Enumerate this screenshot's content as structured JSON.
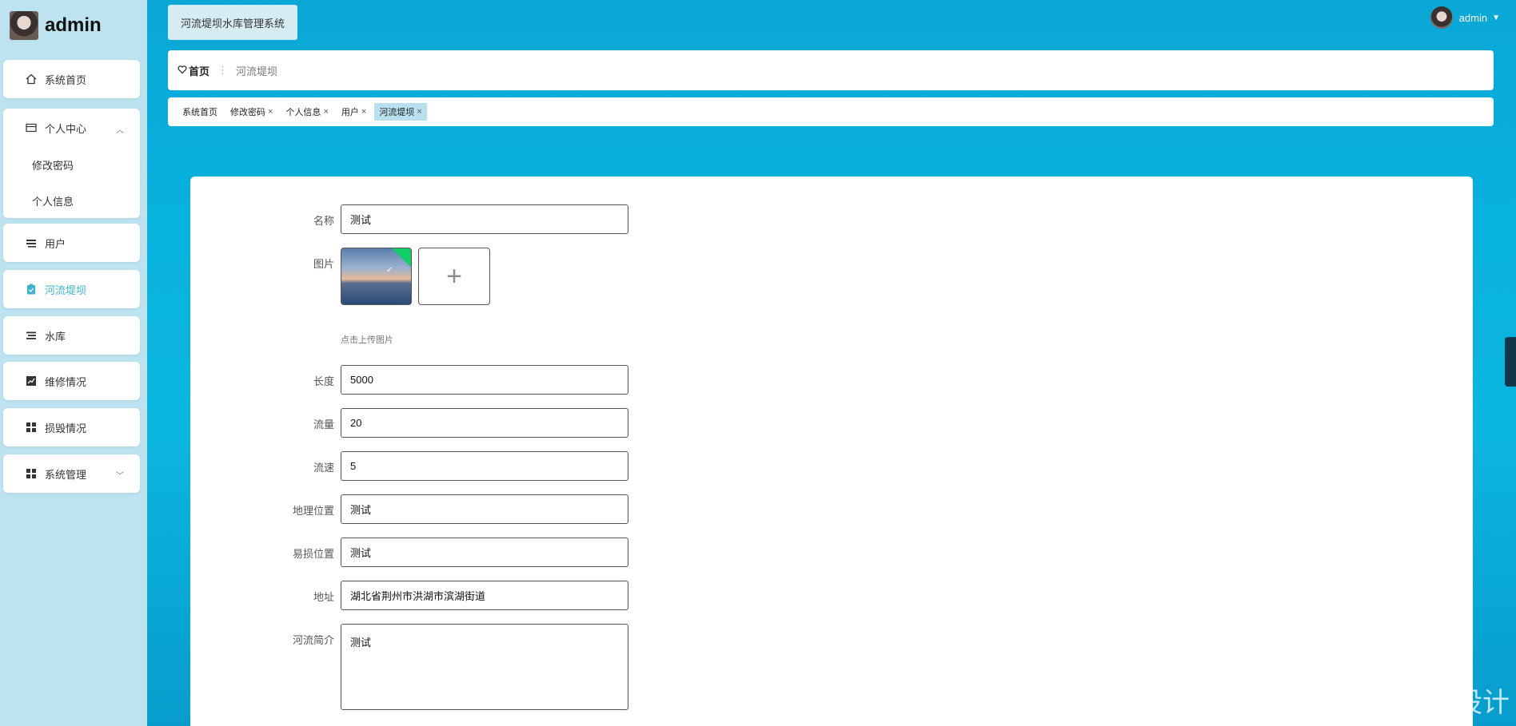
{
  "sidebar": {
    "user": "admin",
    "items": [
      {
        "label": "系统首页",
        "icon": "home-icon"
      },
      {
        "label": "个人中心",
        "icon": "wallet-icon",
        "sub": [
          "修改密码",
          "个人信息"
        ]
      },
      {
        "label": "用户",
        "icon": "list-icon"
      },
      {
        "label": "河流堤坝",
        "icon": "clipboard-icon",
        "active": true
      },
      {
        "label": "水库",
        "icon": "list-icon"
      },
      {
        "label": "维修情况",
        "icon": "chart-icon"
      },
      {
        "label": "损毁情况",
        "icon": "grid-icon"
      },
      {
        "label": "系统管理",
        "icon": "grid-icon"
      }
    ]
  },
  "header": {
    "system_title": "河流堤坝水库管理系统",
    "user": "admin"
  },
  "breadcrumb": {
    "home": "首页",
    "current": "河流堤坝"
  },
  "tags": [
    "系统首页",
    "修改密码",
    "个人信息",
    "用户",
    "河流堤坝"
  ],
  "form": {
    "name_label": "名称",
    "name_value": "测试",
    "image_label": "图片",
    "upload_hint": "点击上传图片",
    "length_label": "长度",
    "length_value": "5000",
    "flow_label": "流量",
    "flow_value": "20",
    "speed_label": "流速",
    "speed_value": "5",
    "geo_label": "地理位置",
    "geo_value": "测试",
    "weak_label": "易损位置",
    "weak_value": "测试",
    "addr_label": "地址",
    "addr_value": "湖北省荆州市洪湖市滨湖街道",
    "intro_label": "河流简介",
    "intro_value": "测试"
  },
  "watermark": "CSDN @成承程序设计",
  "colors": {
    "accent": "#3bb5cf",
    "success": "#13ce66",
    "background": "#0aa7d6"
  }
}
